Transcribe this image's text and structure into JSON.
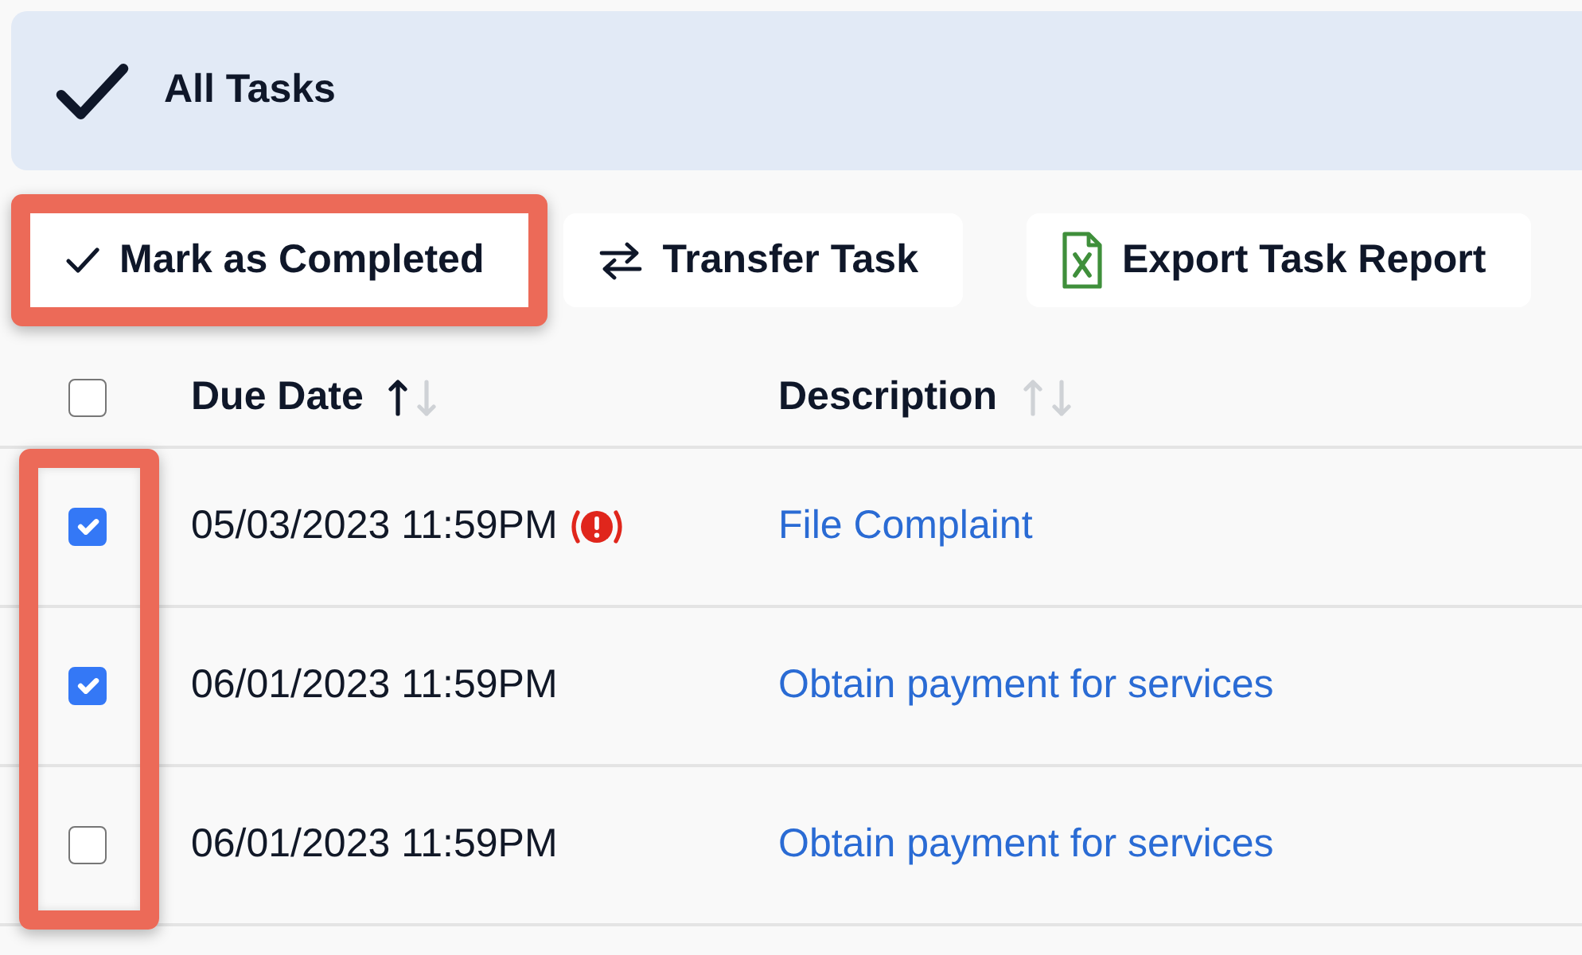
{
  "header": {
    "title": "All Tasks"
  },
  "actions": [
    {
      "kind": "complete",
      "label": "Mark as Completed",
      "highlighted": true
    },
    {
      "kind": "transfer",
      "label": "Transfer Task",
      "highlighted": false
    },
    {
      "kind": "export",
      "label": "Export Task Report",
      "highlighted": false
    }
  ],
  "table": {
    "select_all": {
      "checked": false
    },
    "select_column_highlighted": true,
    "columns": [
      {
        "label": "Due Date",
        "sort_up_active": true,
        "sort_down_active": false
      },
      {
        "label": "Description",
        "sort_up_active": false,
        "sort_down_active": false
      }
    ],
    "rows": [
      {
        "checked": true,
        "due_date": "05/03/2023 11:59PM",
        "overdue": true,
        "description": "File Complaint"
      },
      {
        "checked": true,
        "due_date": "06/01/2023 11:59PM",
        "overdue": false,
        "description": "Obtain payment for services"
      },
      {
        "checked": false,
        "due_date": "06/01/2023 11:59PM",
        "overdue": false,
        "description": "Obtain payment for services"
      }
    ]
  }
}
